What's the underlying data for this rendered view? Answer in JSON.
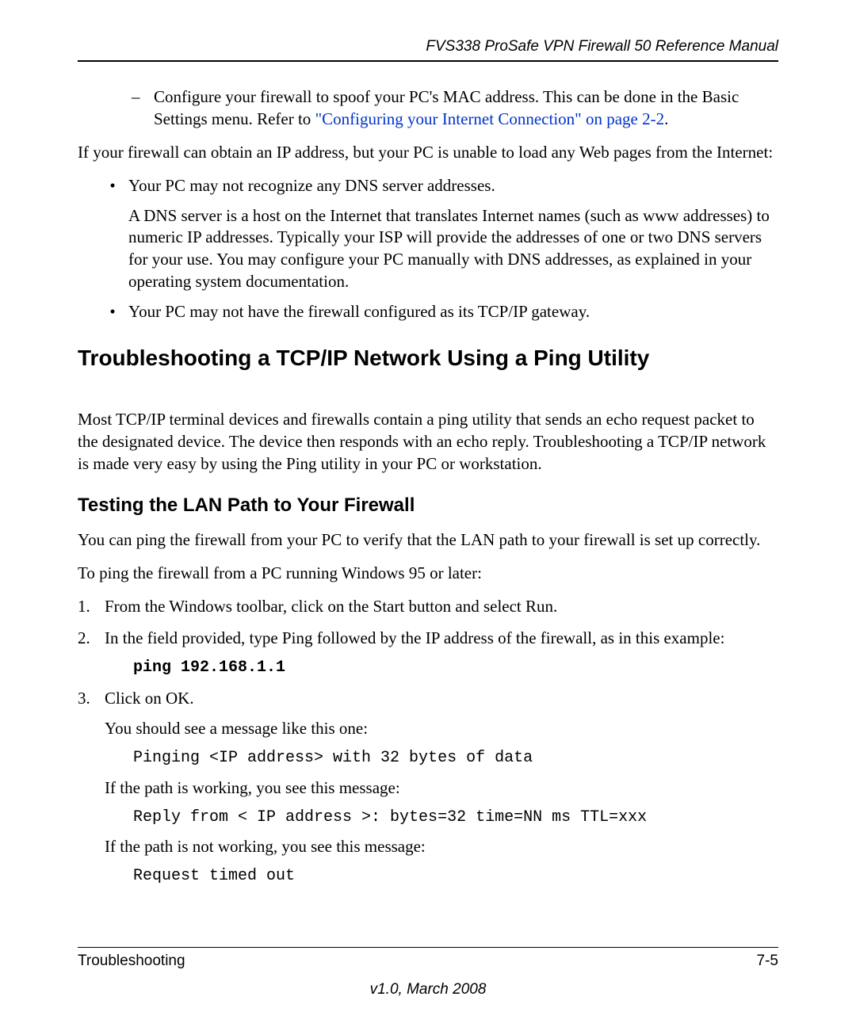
{
  "header": "FVS338 ProSafe VPN Firewall 50 Reference Manual",
  "dash_item": {
    "pre": "Configure your firewall to spoof your PC's MAC address. This can be done in the Basic Settings menu. Refer to ",
    "link": "\"Configuring your Internet Connection\" on page 2-2",
    "post": "."
  },
  "p1": "If your firewall can obtain an IP address, but your PC is unable to load any Web pages from the Internet:",
  "bullets": [
    {
      "lead": "Your PC may not recognize any DNS server addresses.",
      "sub": "A DNS server is a host on the Internet that translates Internet names (such as www addresses) to numeric IP addresses. Typically your ISP will provide the addresses of one or two DNS servers for your use. You may configure your PC manually with DNS addresses, as explained in your operating system documentation."
    },
    {
      "lead": "Your PC may not have the firewall configured as its TCP/IP gateway."
    }
  ],
  "h1": "Troubleshooting a TCP/IP Network Using a Ping Utility",
  "p2": "Most TCP/IP terminal devices and firewalls contain a ping utility that sends an echo request packet to the designated device. The device then responds with an echo reply. Troubleshooting a TCP/IP network is made very easy by using the Ping utility in your PC or workstation.",
  "h2": "Testing the LAN Path to Your Firewall",
  "p3": "You can ping the firewall from your PC to verify that the LAN path to your firewall is set up correctly.",
  "p4": "To ping the firewall from a PC running Windows 95 or later:",
  "steps": [
    {
      "n": "1.",
      "text": "From the Windows toolbar, click on the Start button and select Run."
    },
    {
      "n": "2.",
      "text": "In the field provided, type Ping followed by the IP address of the firewall, as in this example:",
      "code_bold": "ping 192.168.1.1"
    },
    {
      "n": "3.",
      "text": "Click on OK.",
      "after": [
        {
          "type": "para",
          "text": "You should see a message like this one:"
        },
        {
          "type": "code",
          "text": "Pinging <IP address> with 32 bytes of data"
        },
        {
          "type": "para",
          "text": "If the path is working, you see this message:"
        },
        {
          "type": "code",
          "text": "Reply from < IP address >: bytes=32 time=NN ms TTL=xxx"
        },
        {
          "type": "para",
          "text": "If the path is not working, you see this message:"
        },
        {
          "type": "code",
          "text": "Request timed out"
        }
      ]
    }
  ],
  "footer": {
    "left": "Troubleshooting",
    "right": "7-5",
    "version": "v1.0, March 2008"
  }
}
